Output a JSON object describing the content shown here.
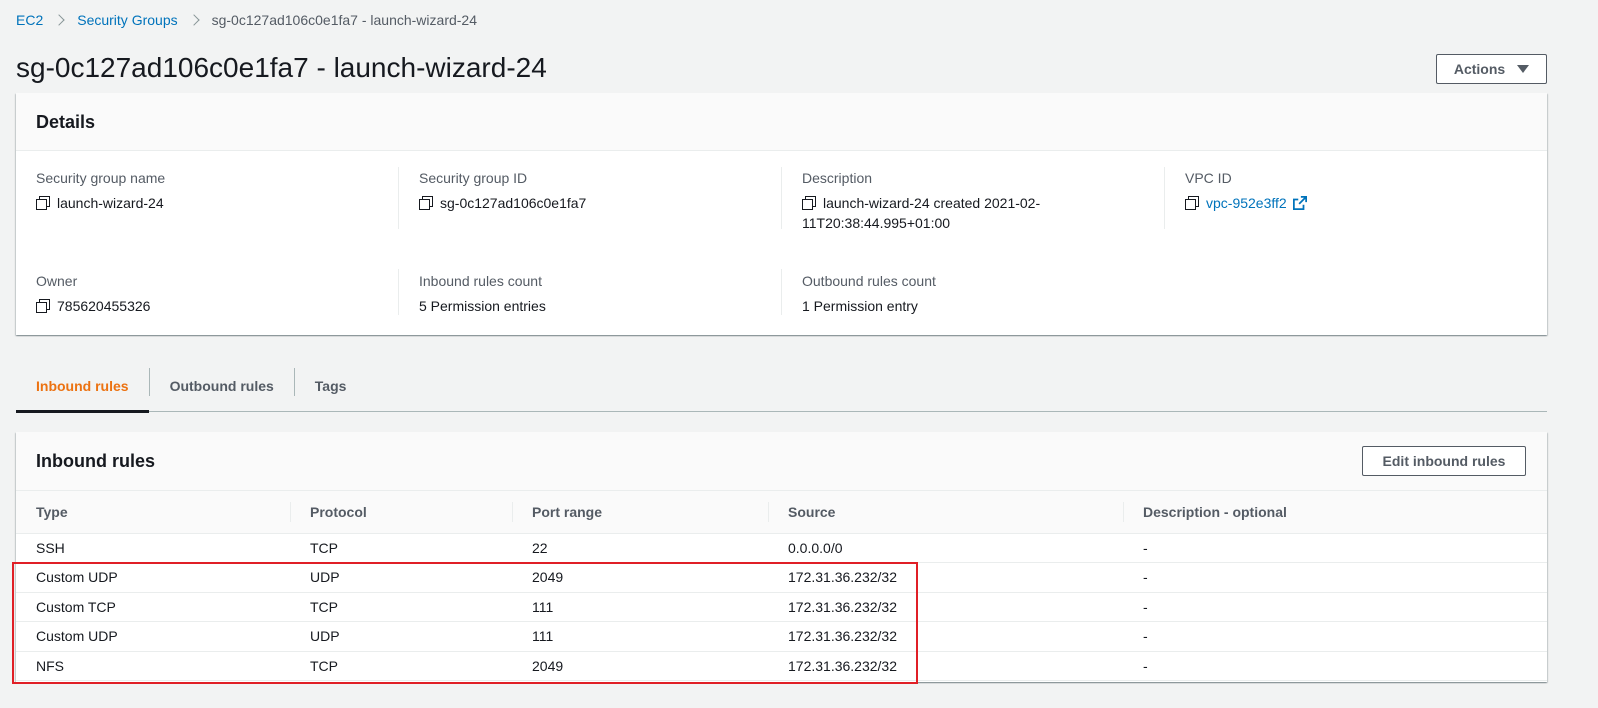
{
  "breadcrumb": {
    "items": [
      {
        "label": "EC2"
      },
      {
        "label": "Security Groups"
      }
    ],
    "current": "sg-0c127ad106c0e1fa7 - launch-wizard-24"
  },
  "page": {
    "title": "sg-0c127ad106c0e1fa7 - launch-wizard-24",
    "actions_label": "Actions"
  },
  "details": {
    "heading": "Details",
    "fields": {
      "sg_name": {
        "label": "Security group name",
        "value": "launch-wizard-24"
      },
      "sg_id": {
        "label": "Security group ID",
        "value": "sg-0c127ad106c0e1fa7"
      },
      "description": {
        "label": "Description",
        "value_line1": "launch-wizard-24 created 2021-02-",
        "value_line2": "11T20:38:44.995+01:00"
      },
      "vpc_id": {
        "label": "VPC ID",
        "value": "vpc-952e3ff2"
      },
      "owner": {
        "label": "Owner",
        "value": "785620455326"
      },
      "inbound_count": {
        "label": "Inbound rules count",
        "value": "5 Permission entries"
      },
      "outbound_count": {
        "label": "Outbound rules count",
        "value": "1 Permission entry"
      }
    }
  },
  "tabs": [
    {
      "label": "Inbound rules",
      "active": true
    },
    {
      "label": "Outbound rules",
      "active": false
    },
    {
      "label": "Tags",
      "active": false
    }
  ],
  "inbound": {
    "title": "Inbound rules",
    "edit_label": "Edit inbound rules",
    "columns": [
      "Type",
      "Protocol",
      "Port range",
      "Source",
      "Description - optional"
    ],
    "rows": [
      [
        "SSH",
        "TCP",
        "22",
        "0.0.0.0/0",
        "-"
      ],
      [
        "Custom UDP",
        "UDP",
        "2049",
        "172.31.36.232/32",
        "-"
      ],
      [
        "Custom TCP",
        "TCP",
        "111",
        "172.31.36.232/32",
        "-"
      ],
      [
        "Custom UDP",
        "UDP",
        "111",
        "172.31.36.232/32",
        "-"
      ],
      [
        "NFS",
        "TCP",
        "2049",
        "172.31.36.232/32",
        "-"
      ]
    ]
  },
  "colors": {
    "link": "#0073bb",
    "active_tab": "#ec7211",
    "highlight": "#e01f26"
  },
  "icons": [
    "chevron-right-icon",
    "caret-down-icon",
    "copy-icon",
    "external-link-icon"
  ]
}
